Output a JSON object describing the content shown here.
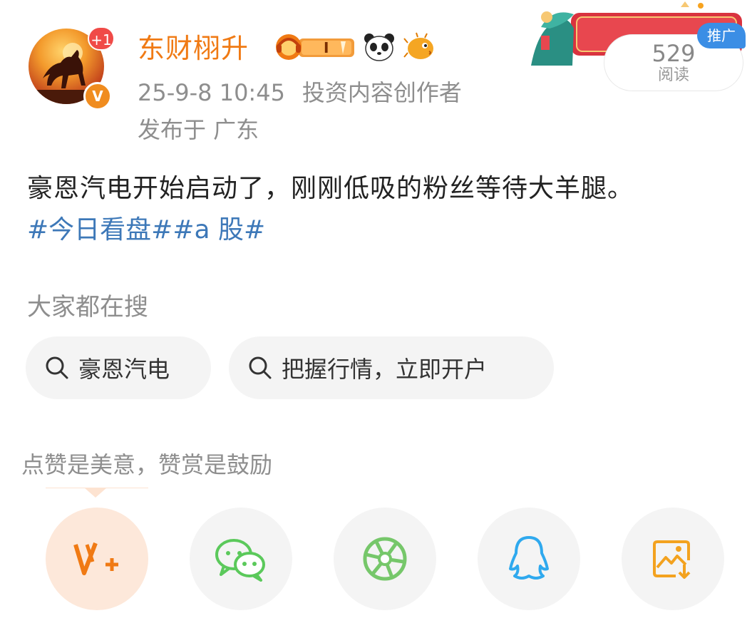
{
  "user": {
    "name": "东财栩升",
    "notification_badge": "+1",
    "verified_mark": "V",
    "date": "25-9-8 10:45",
    "role": "投资内容创作者",
    "location": "发布于 广东",
    "medals": [
      "headphone-medal-icon",
      "panda-medal-icon",
      "puffer-fish-medal-icon"
    ],
    "medal_letter": "I"
  },
  "reads": {
    "count": "529",
    "label": "阅读",
    "ad_tag": "推广"
  },
  "post": {
    "text": "豪恩汽电开始启动了，刚刚低吸的粉丝等待大羊腿。",
    "hashtags": "#今日看盘##a 股#"
  },
  "search": {
    "title": "大家都在搜",
    "chips": [
      "豪恩汽电",
      "把握行情，立即开户"
    ]
  },
  "reward": {
    "title": "点赞是美意，赞赏是鼓励"
  },
  "share_actions": [
    "v-plus-reward-icon",
    "wechat-icon",
    "moments-icon",
    "qq-icon",
    "save-image-icon"
  ],
  "colors": {
    "username": "#f07a14",
    "hashtag": "#3d78b8",
    "ad_tag": "#3b8ee5",
    "wechat": "#5bc95b",
    "qq": "#2fa9ee",
    "save": "#f3a21f"
  }
}
